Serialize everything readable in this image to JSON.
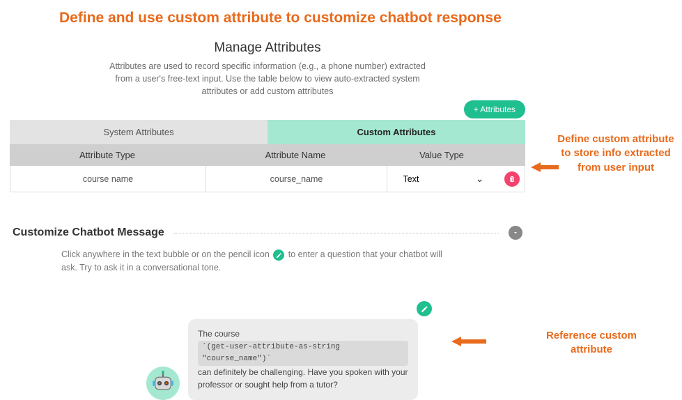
{
  "page_title": "Define and use custom attribute to customize chatbot response",
  "manage_attributes": {
    "heading": "Manage Attributes",
    "description": "Attributes are used to record specific information (e.g., a phone number) extracted from a user's free-text input. Use the table below to view auto-extracted system attributes or add custom attributes",
    "add_button": "+ Attributes",
    "tabs": {
      "system": "System Attributes",
      "custom": "Custom Attributes"
    },
    "columns": {
      "type": "Attribute Type",
      "name": "Attribute Name",
      "value": "Value Type"
    },
    "rows": [
      {
        "type": "course name",
        "name": "course_name",
        "value_type": "Text"
      }
    ]
  },
  "customize_message": {
    "heading": "Customize Chatbot Message",
    "desc_before": "Click anywhere in the text bubble or on the pencil icon ",
    "desc_after": " to enter a question that your chatbot will ask. Try to ask it in a conversational tone.",
    "bubble": {
      "line1": "The course ",
      "chip": "`(get-user-attribute-as-string \"course_name\")`",
      "line2_a": " can definitely be challenging. Have you spoken with your professor or sought help from a tutor?"
    }
  },
  "annotations": {
    "define": "Define custom attribute to store info extracted from user input",
    "reference": "Reference custom attribute"
  },
  "colors": {
    "accent_orange": "#E86A1C",
    "accent_green": "#1FBF8F"
  }
}
